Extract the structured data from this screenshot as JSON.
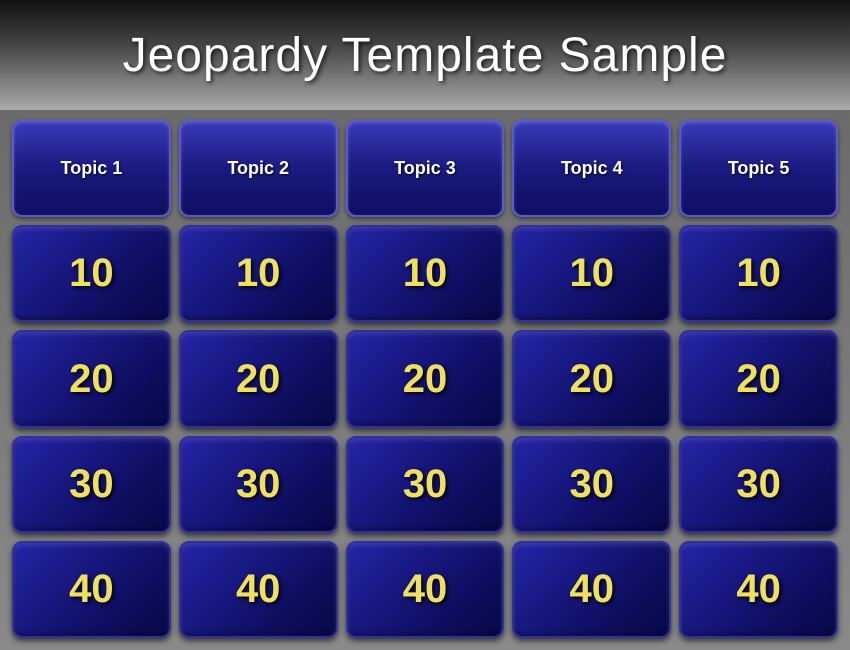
{
  "header": {
    "title": "Jeopardy Template Sample"
  },
  "board": {
    "topics": [
      {
        "id": "topic1",
        "label": "Topic 1"
      },
      {
        "id": "topic2",
        "label": "Topic 2"
      },
      {
        "id": "topic3",
        "label": "Topic 3"
      },
      {
        "id": "topic4",
        "label": "Topic 4"
      },
      {
        "id": "topic5",
        "label": "Topic 5"
      }
    ],
    "rows": [
      {
        "value": "10"
      },
      {
        "value": "20"
      },
      {
        "value": "30"
      },
      {
        "value": "40"
      }
    ]
  }
}
